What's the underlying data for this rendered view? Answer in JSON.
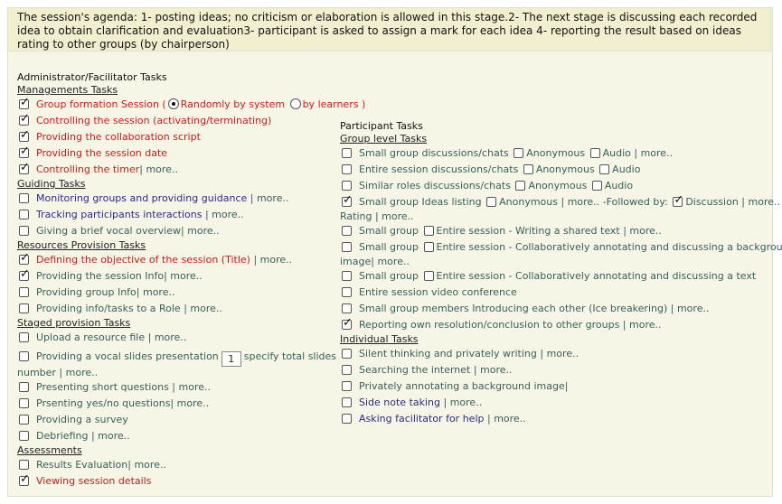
{
  "agenda": "The session's agenda: 1- posting ideas; no criticism or elaboration is allowed in this stage.2- The next stage is discussing each recorded idea to obtain clarification and evaluation3- participant is asked to assign a mark for each idea 4- reporting the result based on ideas rating to other groups (by chairperson)",
  "more": "more..",
  "admin": {
    "title": "Administrator/Facilitator Tasks",
    "managements": {
      "header": "Managements Tasks",
      "group_formation": "Group formation Session (",
      "random": "Randomly by system",
      "learners": "by learners )",
      "controlling_session": "Controlling the session (activating/terminating)",
      "collab_script": "Providing the collaboration script",
      "session_date": "Providing the session date",
      "timer": "Controlling the timer"
    },
    "guiding": {
      "header": "Guiding Tasks",
      "monitoring": "Monitoring groups and providing guidance",
      "tracking": "Tracking participants interactions",
      "vocal": "Giving a brief vocal overview"
    },
    "resources": {
      "header": "Resources Provision Tasks",
      "objective": "Defining the objective of the session (Title)",
      "session_info": "Providing the session Info",
      "group_info": "Providing group Info",
      "role_info": "Providing info/tasks to a Role"
    },
    "staged": {
      "header": "Staged provision Tasks",
      "upload": "Upload a resource file",
      "slides": "Providing a vocal slides presentation",
      "slides_num": "1",
      "slides_after": "specify total slides",
      "number": "number",
      "short_q": "Presenting short questions",
      "yesno_q": "Prsenting yes/no questions",
      "survey": "Providing a survey",
      "debriefing": "Debriefing"
    },
    "assessments": {
      "header": "Assessments",
      "results": "Results Evaluation",
      "viewing": "Viewing session details"
    }
  },
  "participant": {
    "title": "Participant Tasks",
    "group": {
      "header": "Group level Tasks",
      "small_disc": "Small group discussions/chats",
      "entire_disc": "Entire session discussions/chats",
      "similar_disc": "Similar roles discussions/chats",
      "anonymous": "Anonymous",
      "audio": "Audio",
      "ideas": "Small group Ideas listing",
      "followed": "-Followed by:",
      "discussion": "Discussion",
      "rating": "Rating",
      "small_group": "Small group",
      "entire_session_writing": "Entire session - Writing a shared text",
      "entire_session_bg": "Entire session - Collaboratively annotating and discussing a background",
      "image": "image",
      "entire_session_text": "Entire session - Collaboratively annotating and discussing a text",
      "video": "Entire session video conference",
      "icebreaking": "Small group members Introducing each other (Ice breakering)",
      "reporting": "Reporting own resolution/conclusion to other groups"
    },
    "individual": {
      "header": "Individual Tasks",
      "silent": "Silent thinking and privately writing",
      "searching": "Searching the internet",
      "annotating": "Privately annotating a background image",
      "side_note": "Side note taking",
      "asking": "Asking facilitator for help"
    }
  }
}
